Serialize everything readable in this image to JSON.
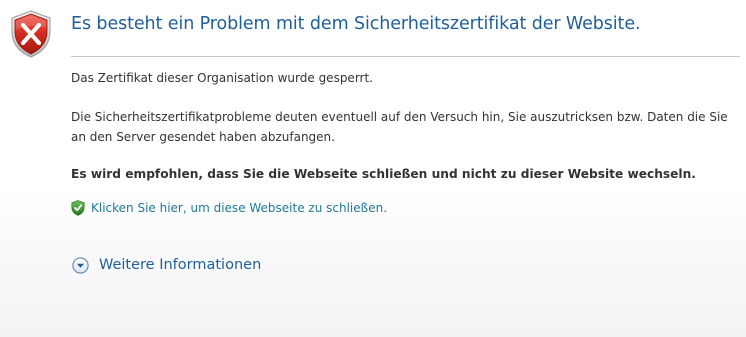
{
  "header": {
    "title": "Es besteht ein Problem mit dem Sicherheitszertifikat der Website."
  },
  "content": {
    "paragraph1": "Das Zertifikat dieser Organisation wurde gesperrt.",
    "paragraph2": "Die Sicherheitszertifikatprobleme deuten eventuell auf den Versuch hin, Sie auszutricksen bzw. Daten die Sie an den Server gesendet haben abzufangen.",
    "recommendation": "Es wird empfohlen, dass Sie die Webseite schließen und nicht zu dieser Website wechseln.",
    "close_link": "Klicken Sie hier, um diese Webseite zu schließen.",
    "more_info": "Weitere Informationen"
  },
  "icons": {
    "error": "error-shield-icon",
    "close_link": "green-shield-check-icon",
    "expand": "chevron-down-circle-icon"
  },
  "colors": {
    "title": "#1f5f9a",
    "link": "#1f7a97",
    "error_red": "#d9261c",
    "shield_green": "#2e8b2e"
  }
}
